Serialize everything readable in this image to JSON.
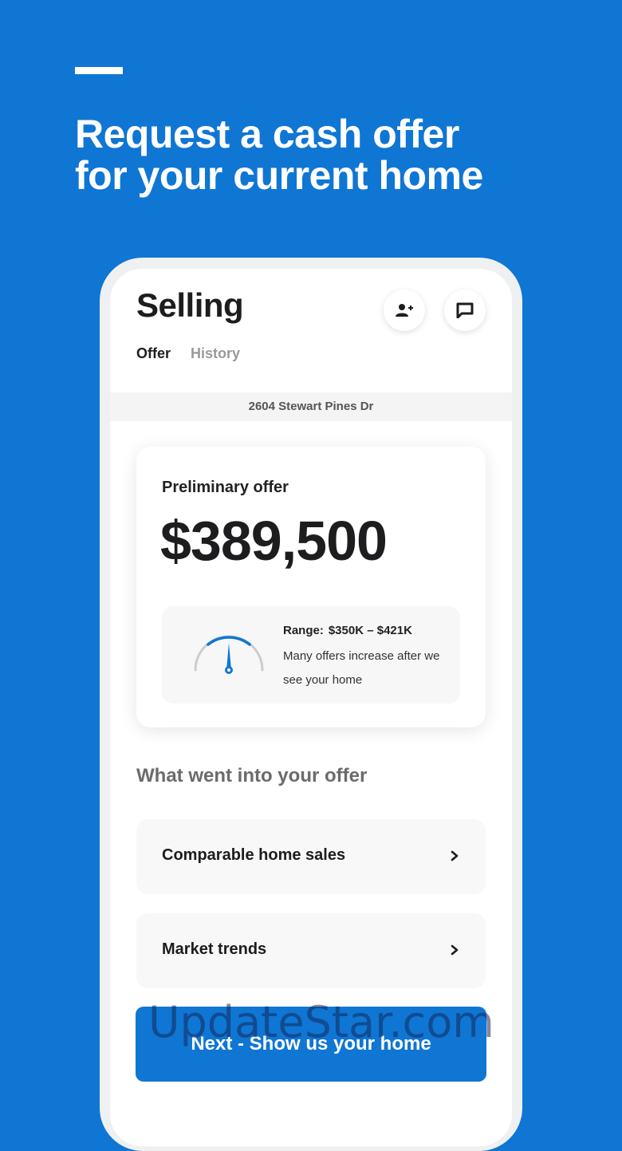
{
  "colors": {
    "brand_blue": "#0f76d4",
    "text_dark": "#1d1d1f",
    "muted": "#9a9a9a"
  },
  "promo": {
    "headline_line1": "Request a cash offer",
    "headline_line2": "for your current home"
  },
  "header": {
    "title": "Selling",
    "icons": [
      "add-person-icon",
      "chat-icon"
    ]
  },
  "tabs": [
    {
      "label": "Offer",
      "active": true
    },
    {
      "label": "History",
      "active": false
    }
  ],
  "address": "2604 Stewart Pines Dr",
  "offer": {
    "label": "Preliminary offer",
    "amount": "$389,500",
    "range_label": "Range:",
    "range_value": "$350K – $421K",
    "note": "Many offers increase after we see your home"
  },
  "breakdown": {
    "heading": "What went into your offer",
    "items": [
      {
        "label": "Comparable home sales",
        "icon": "chevron-right-icon"
      },
      {
        "label": "Market trends",
        "icon": "chevron-right-icon"
      }
    ]
  },
  "cta": {
    "label": "Next - Show us your home"
  },
  "watermark": "UpdateStar.com"
}
